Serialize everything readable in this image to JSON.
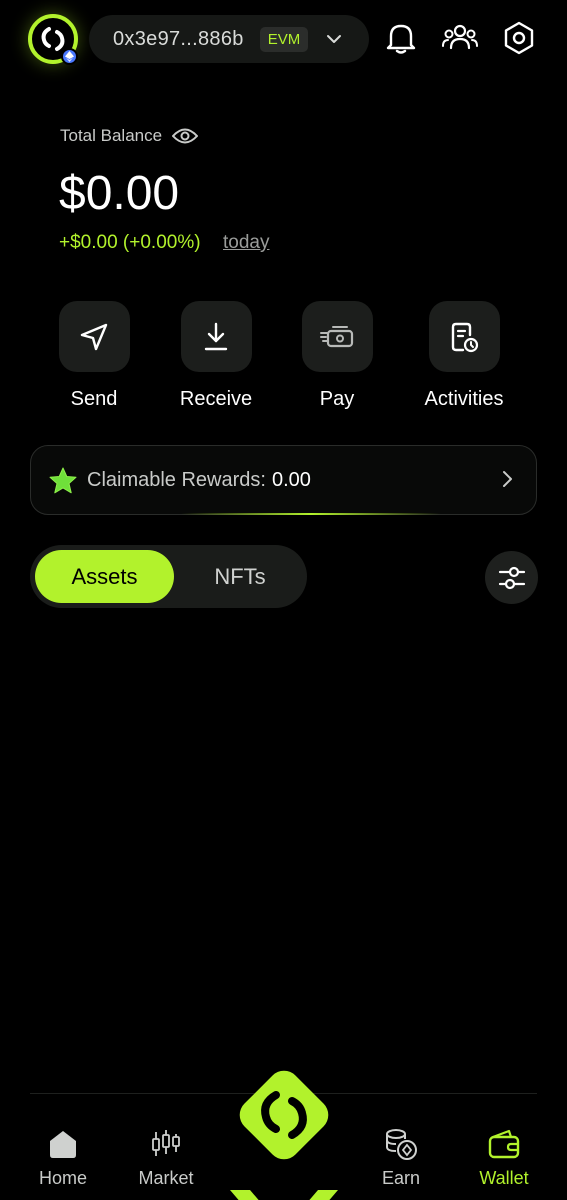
{
  "header": {
    "address": "0x3e97...886b",
    "network_tag": "EVM"
  },
  "balance": {
    "label": "Total Balance",
    "value": "$0.00",
    "change": "+$0.00 (+0.00%)",
    "period": "today"
  },
  "actions": [
    {
      "label": "Send",
      "icon": "send-icon"
    },
    {
      "label": "Receive",
      "icon": "download-icon"
    },
    {
      "label": "Pay",
      "icon": "pay-icon"
    },
    {
      "label": "Activities",
      "icon": "activities-icon"
    }
  ],
  "rewards": {
    "label": "Claimable Rewards:",
    "value": "0.00"
  },
  "tabs": [
    {
      "label": "Assets",
      "active": true
    },
    {
      "label": "NFTs",
      "active": false
    }
  ],
  "nav": [
    {
      "label": "Home",
      "icon": "home-icon"
    },
    {
      "label": "Market",
      "icon": "candlestick-icon"
    },
    {
      "label": "Earn",
      "icon": "coins-icon"
    },
    {
      "label": "Wallet",
      "icon": "wallet-icon",
      "active": true
    }
  ],
  "colors": {
    "accent": "#b2f22c",
    "background": "#000000",
    "surface": "#1c1e1c"
  }
}
